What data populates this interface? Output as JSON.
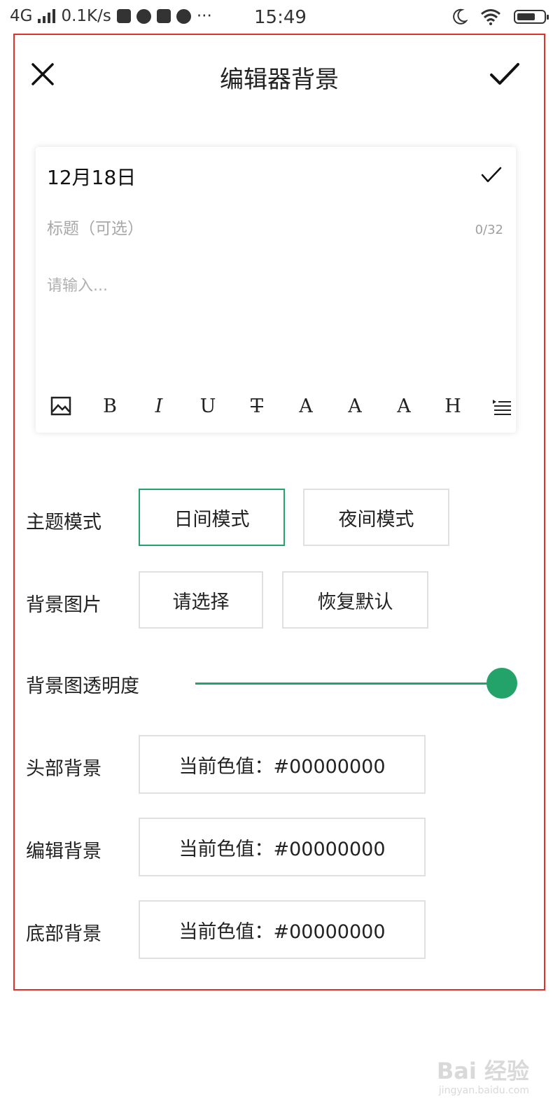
{
  "status_bar": {
    "network": "4G",
    "speed": "0.1K/s",
    "time": "15:49",
    "battery_level": 0.7
  },
  "header": {
    "title": "编辑器背景"
  },
  "editor": {
    "date": "12月18日",
    "title_placeholder": "标题（可选）",
    "title_count": "0/32",
    "body_placeholder": "请输入...",
    "toolbar": [
      "image-icon",
      "B",
      "I",
      "U",
      "T",
      "A",
      "A",
      "A",
      "H",
      "indent-icon"
    ]
  },
  "settings": {
    "theme_label": "主题模式",
    "day_mode": "日间模式",
    "night_mode": "夜间模式",
    "bg_image_label": "背景图片",
    "choose": "请选择",
    "restore_default": "恢复默认",
    "opacity_label": "背景图透明度",
    "opacity_value": 1.0,
    "header_bg_label": "头部背景",
    "header_bg_value": "当前色值：#00000000",
    "editor_bg_label": "编辑背景",
    "editor_bg_value": "当前色值：#00000000",
    "footer_bg_label": "底部背景",
    "footer_bg_value": "当前色值：#00000000"
  },
  "colors": {
    "accent": "#23a36a",
    "frame": "#e0302a"
  },
  "watermark": {
    "brand": "Bai 经验",
    "url": "jingyan.baidu.com"
  }
}
